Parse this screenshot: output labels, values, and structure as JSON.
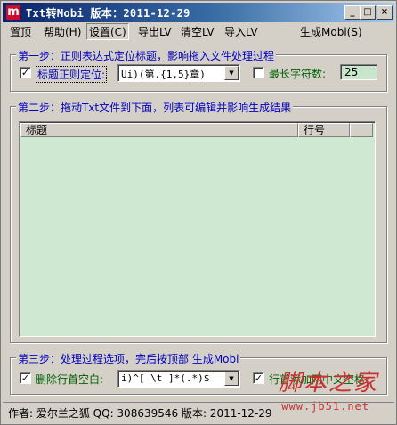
{
  "window": {
    "title": "Txt转Mobi  版本：2011-12-29",
    "icon_letter": "m",
    "controls": {
      "minimize": "_",
      "maximize": "□",
      "close": "×"
    }
  },
  "menu": {
    "items": [
      {
        "label": "置顶"
      },
      {
        "label": "帮助(H)"
      },
      {
        "label": "设置(C)"
      },
      {
        "label": "导出LV"
      },
      {
        "label": "清空LV"
      },
      {
        "label": "导入LV"
      },
      {
        "label": "生成Mobi(S)"
      }
    ]
  },
  "step1": {
    "title": "第一步：正则表达式定位标题，影响拖入文件处理过程",
    "regex_checkbox_checked": true,
    "regex_label": "标题正则定位:",
    "regex_value": "Ui)(第.{1,5}章)",
    "maxlen_checkbox_checked": false,
    "maxlen_label": "最长字符数:",
    "maxlen_value": "25"
  },
  "step2": {
    "title": "第二步：拖动Txt文件到下面，列表可编辑并影响生成结果",
    "columns": [
      "标题",
      "行号"
    ]
  },
  "step3": {
    "title": "第三步：处理过程选项，完后按顶部 生成Mobi",
    "trim_checkbox_checked": true,
    "trim_label": "删除行首空白:",
    "trim_value": "i)^[ \\t  ]*(.*)$",
    "addspace_checkbox_checked": true,
    "addspace_label": "行首添加两中文空格"
  },
  "status": {
    "text": "作者: 爱尔兰之狐   QQ: 308639546   版本: 2011-12-29"
  },
  "watermark": {
    "main": "脚本之家",
    "url": "www.jb51.net"
  },
  "colors": {
    "title_gradient_start": "#0a246a",
    "group_title": "#0000c0",
    "label_green": "#006000",
    "list_bg": "#cfe8d2",
    "watermark": "#c83232"
  }
}
